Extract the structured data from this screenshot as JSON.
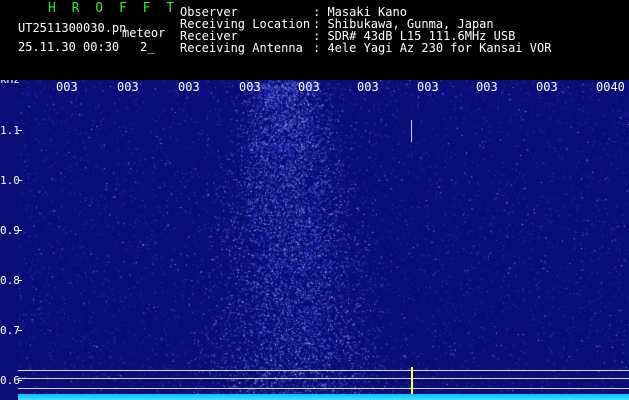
{
  "header": {
    "brand": "H R O F F T",
    "filename": "UT2511300030.pn",
    "meteor": "meteor",
    "datetime": "25.11.30 00:30",
    "index": "2_",
    "observer_label": "Observer",
    "observer_value": ": Masaki Kano",
    "location_label": "Receiving Location",
    "location_value": ": Shibukawa, Gunma, Japan",
    "receiver_label": "Receiver",
    "receiver_value": ": SDR# 43dB L15 111.6MHz USB",
    "antenna_label": "Receiving Antenna",
    "antenna_value": ": 4ele Yagi Az 230 for Kansai VOR"
  },
  "spectrogram": {
    "unit": "kHz",
    "time_ticks": [
      "003",
      "003",
      "003",
      "003",
      "003",
      "003",
      "003",
      "003",
      "003",
      "0040"
    ],
    "freq_ticks": [
      "1.1",
      "1.0",
      "0.9",
      "0.8",
      "0.7",
      "0.6"
    ],
    "background_color": "#0a0d78",
    "dot_color": "#3d6bff",
    "band_color": "#1fcfff",
    "marker_color": "#ffff40"
  }
}
